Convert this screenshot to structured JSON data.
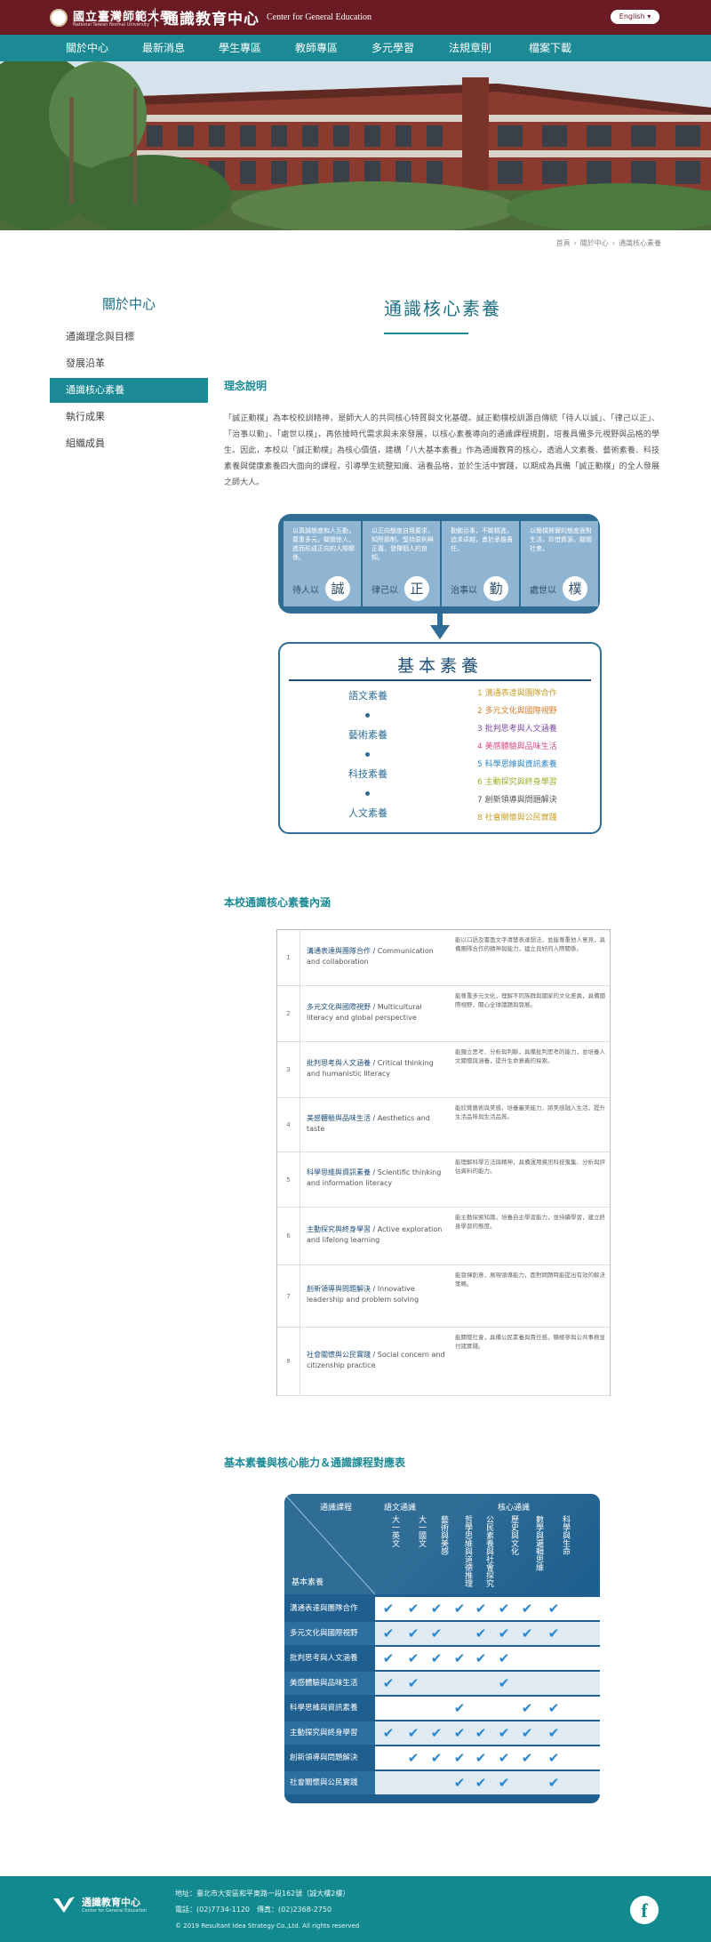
{
  "header": {
    "university": "國立臺灣師範大學",
    "university_en": "National Taiwan Normal University",
    "center": "通識教育中心",
    "center_en": "Center for General Education",
    "lang_button": "English ▾"
  },
  "nav": [
    "關於中心",
    "最新消息",
    "學生專區",
    "教師專區",
    "多元學習",
    "法規章則",
    "檔案下載"
  ],
  "breadcrumb": [
    "首頁",
    "關於中心",
    "通識核心素養"
  ],
  "sidebar": {
    "title": "關於中心",
    "items": [
      "通識理念與目標",
      "發展沿革",
      "通識核心素養",
      "執行成果",
      "組織成員"
    ],
    "active": 2
  },
  "main": {
    "title": "通識核心素養",
    "section1_title": "理念說明",
    "intro": "「誠正勤樸」為本校校訓精神，是師大人的共同核心特質與文化基礎。誠正勤樸校訓源自傳統「待人以誠」、「律己以正」、「治事以勤」、「處世以樸」，再依據時代需求與未來發展，以核心素養導向的通識課程規劃，培養具備多元視野與品格的學生。因此，本校以「誠正勤樸」為核心價值，建構「八大基本素養」作為通識教育的核心，透過人文素養、藝術素養、科技素養與健康素養四大面向的課程，引導學生統整知識、涵養品格，並於生活中實踐，以期成為具備「誠正勤樸」的全人發展之師大人。"
  },
  "diagram": {
    "virtues": [
      {
        "desc": "以真誠態度和人互動，尊重多元，關懷他人，進而形成正向的人際關係。",
        "lead": "待人以",
        "char": "誠"
      },
      {
        "desc": "以正向態度自我要求，知所節制，堅持原則與正義，發揮個人的良知。",
        "lead": "律己以",
        "char": "正"
      },
      {
        "desc": "勤勉治事，不斷精進，追求卓越，勇於承擔責任。",
        "lead": "治事以",
        "char": "勤"
      },
      {
        "desc": "以簡樸務實的態度面對生活，珍惜資源，關懷社會。",
        "lead": "處世以",
        "char": "樸"
      }
    ],
    "basic_title": "基本素養",
    "domains": [
      "語文素養",
      "藝術素養",
      "科技素養",
      "人文素養"
    ],
    "literacies": [
      {
        "text": "1 溝通表達與團隊合作",
        "color": "#c9a02a"
      },
      {
        "text": "2 多元文化與國際視野",
        "color": "#d97c2a"
      },
      {
        "text": "3 批判思考與人文涵養",
        "color": "#7c4aa0"
      },
      {
        "text": "4 美感體驗與品味生活",
        "color": "#d94f8a"
      },
      {
        "text": "5 科學思維與資訊素養",
        "color": "#2a87c9"
      },
      {
        "text": "6 主動探究與終身學習",
        "color": "#9aaf2a"
      },
      {
        "text": "7 創新領導與問題解決",
        "color": "#555555"
      },
      {
        "text": "8 社會關懷與公民實踐",
        "color": "#c9a02a"
      }
    ]
  },
  "table1": {
    "title": "本校通識核心素養內涵",
    "rows": [
      {
        "num": "1",
        "zh": "溝通表達與團隊合作 / ",
        "en": "Communication and collaboration",
        "desc": "能以口語及書面文字清楚表達想法，並能尊重他人意見，具備團隊合作的精神與能力，建立良好的人際關係。"
      },
      {
        "num": "2",
        "zh": "多元文化與國際視野 / ",
        "en": "Multicultural literacy and global perspective",
        "desc": "能尊重多元文化，理解不同族群與國家的文化差異，具備國際視野，關心全球議題與發展。"
      },
      {
        "num": "3",
        "zh": "批判思考與人文涵養 / ",
        "en": "Critical thinking and humanistic literacy",
        "desc": "能獨立思考、分析與判斷，具備批判思考的能力，並培養人文關懷與涵養，提升生命意義的探索。"
      },
      {
        "num": "4",
        "zh": "美感體驗與品味生活 / ",
        "en": "Aesthetics and taste",
        "desc": "能欣賞藝術與美感，培養審美能力，將美感融入生活，提升生活品味與生活品質。"
      },
      {
        "num": "5",
        "zh": "科學思維與資訊素養 / ",
        "en": "Scientific thinking and information literacy",
        "desc": "能理解科學方法與精神，具備運用資訊科技蒐集、分析與評估資料的能力。"
      },
      {
        "num": "6",
        "zh": "主動探究與終身學習 / ",
        "en": "Active exploration and lifelong learning",
        "desc": "能主動探索知識，培養自主學習能力，並持續學習，建立終身學習的態度。"
      },
      {
        "num": "7",
        "zh": "創新領導與問題解決 / ",
        "en": "Innovative leadership and problem solving",
        "desc": "能發揮創意，展現領導能力，面對問題時能提出有效的解決策略。"
      },
      {
        "num": "8",
        "zh": "社會關懷與公民實踐 / ",
        "en": "Social concern and citizenship practice",
        "desc": "能關懷社會，具備公民素養與責任感，積極參與公共事務並付諸實踐。"
      }
    ]
  },
  "matrix": {
    "title": "基本素養與核心能力＆通識課程對應表",
    "corner_top": "通識課程",
    "corner_bottom": "基本素養",
    "group1": "語文通識",
    "group2": "核心通識",
    "columns": [
      "大一英文",
      "大一國文",
      "藝術與美感",
      "哲學思維與道德推理",
      "公民素養與社會探究",
      "歷史與文化",
      "數學與邏輯思維",
      "科學與生命"
    ],
    "rows": [
      {
        "label": "溝通表達與團隊合作",
        "checks": [
          1,
          1,
          1,
          1,
          1,
          1,
          1,
          1
        ]
      },
      {
        "label": "多元文化與國際視野",
        "checks": [
          1,
          1,
          1,
          0,
          1,
          1,
          1,
          1
        ]
      },
      {
        "label": "批判思考與人文涵養",
        "checks": [
          1,
          1,
          1,
          1,
          1,
          1,
          0,
          0
        ]
      },
      {
        "label": "美感體驗與品味生活",
        "checks": [
          1,
          1,
          0,
          0,
          0,
          1,
          0,
          0
        ]
      },
      {
        "label": "科學思維與資訊素養",
        "checks": [
          0,
          0,
          0,
          1,
          0,
          0,
          1,
          1
        ]
      },
      {
        "label": "主動探究與終身學習",
        "checks": [
          1,
          1,
          1,
          1,
          1,
          1,
          1,
          1
        ]
      },
      {
        "label": "創新領導與問題解決",
        "checks": [
          0,
          1,
          1,
          1,
          1,
          1,
          1,
          1
        ]
      },
      {
        "label": "社會關懷與公民實踐",
        "checks": [
          0,
          0,
          0,
          1,
          1,
          1,
          0,
          1
        ]
      }
    ]
  },
  "footer": {
    "name": "通識教育中心",
    "name_en": "Center for General Education",
    "address": "地址：臺北市大安區和平東路一段162號（誠大樓2樓）",
    "phone": "電話：(02)7734-1120　傳真：(02)2368-2750",
    "copyright": "© 2019 Resultant Idea Strategy Co.,Ltd. All rights reserved",
    "social": "f"
  }
}
